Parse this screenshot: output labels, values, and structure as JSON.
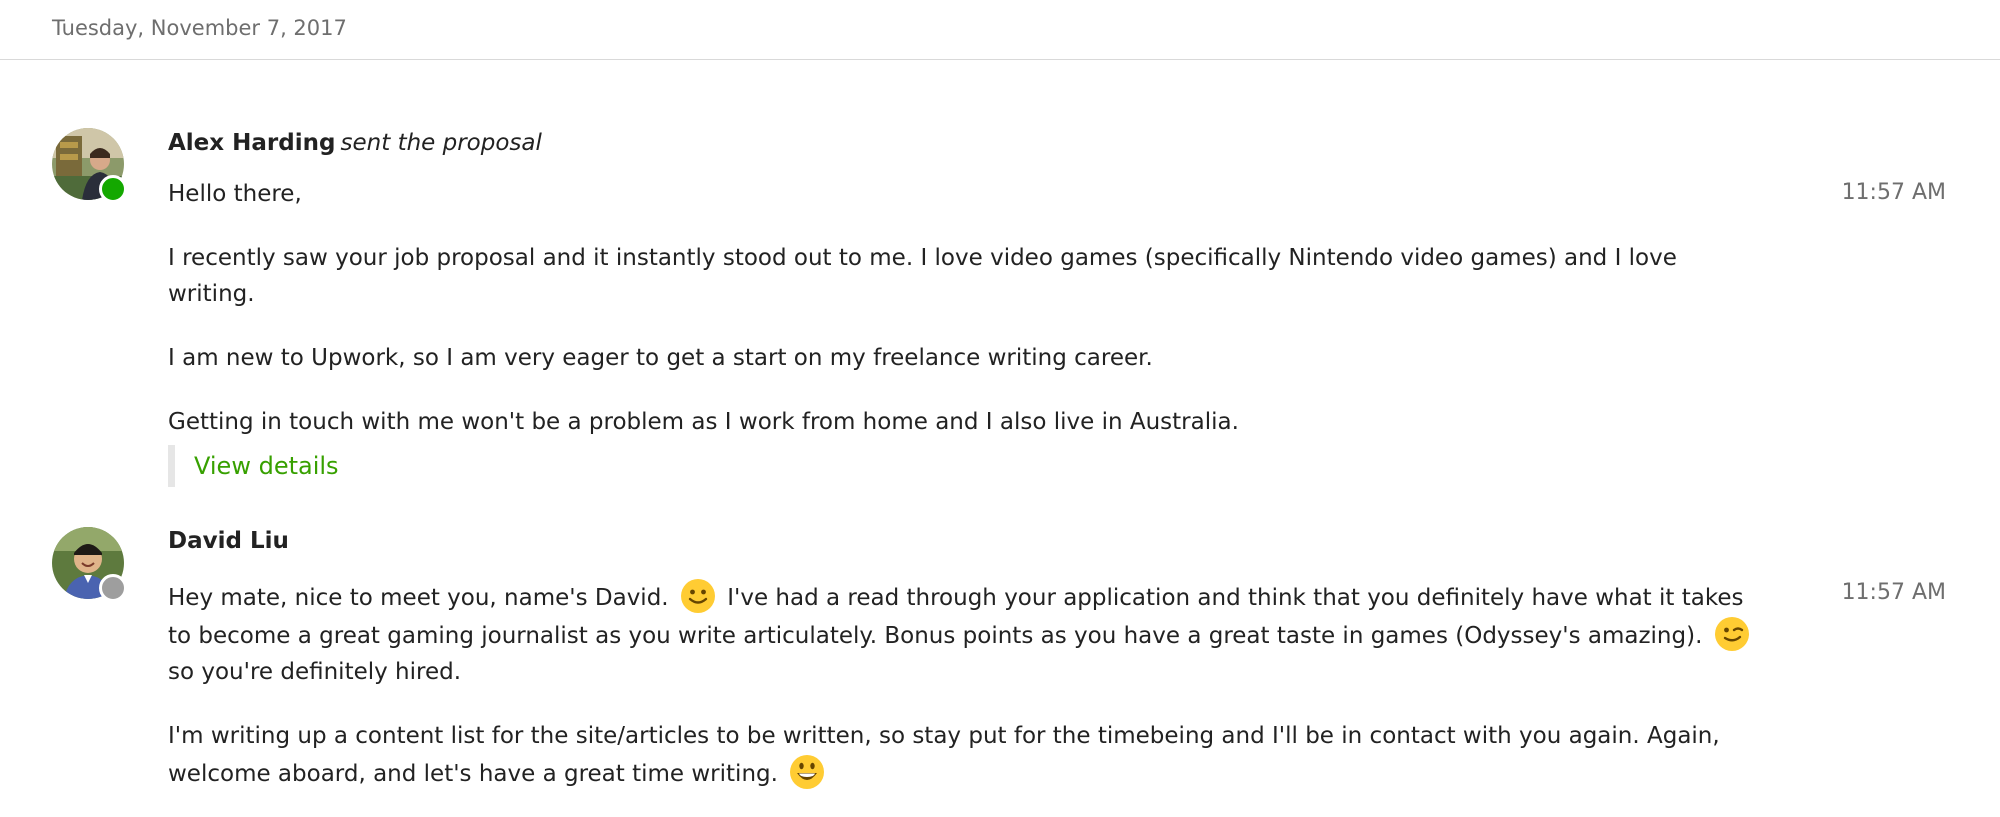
{
  "date_header": "Tuesday, November 7, 2017",
  "colors": {
    "accent_green": "#37a000",
    "online_green": "#14a800",
    "offline_gray": "#9e9e9e",
    "muted_text": "#6e6e6e"
  },
  "messages": [
    {
      "sender": "Alex Harding",
      "action": "sent the proposal",
      "time": "11:57 AM",
      "status": "online",
      "paragraphs": [
        "Hello there,",
        "I recently saw your job proposal and it instantly stood out to me. I love video games (specifically Nintendo video games) and I love writing.",
        "I am new to Upwork, so I am very eager to get a start on my freelance writing career.",
        "Getting in touch with me won't be a problem as I work from home and I also live in Australia."
      ],
      "details_link": "View details"
    },
    {
      "sender": "David Liu",
      "time": "11:57 AM",
      "status": "offline",
      "p1_a": "Hey mate, nice to meet you, name's David.",
      "p1_b": "I've had a read through your application and think that you definitely have what it takes to become a great gaming journalist as you write articulately. Bonus points as you have a great taste in games (Odyssey's amazing).",
      "p1_c": "so you're definitely hired.",
      "p2": "I'm writing up a content list for the site/articles to be written, so stay put for the timebeing and I'll be in contact with you again. Again, welcome aboard, and let's have a great time writing.",
      "emojis": [
        "slightly-smiling-face",
        "winking-face",
        "grinning-face"
      ]
    }
  ]
}
